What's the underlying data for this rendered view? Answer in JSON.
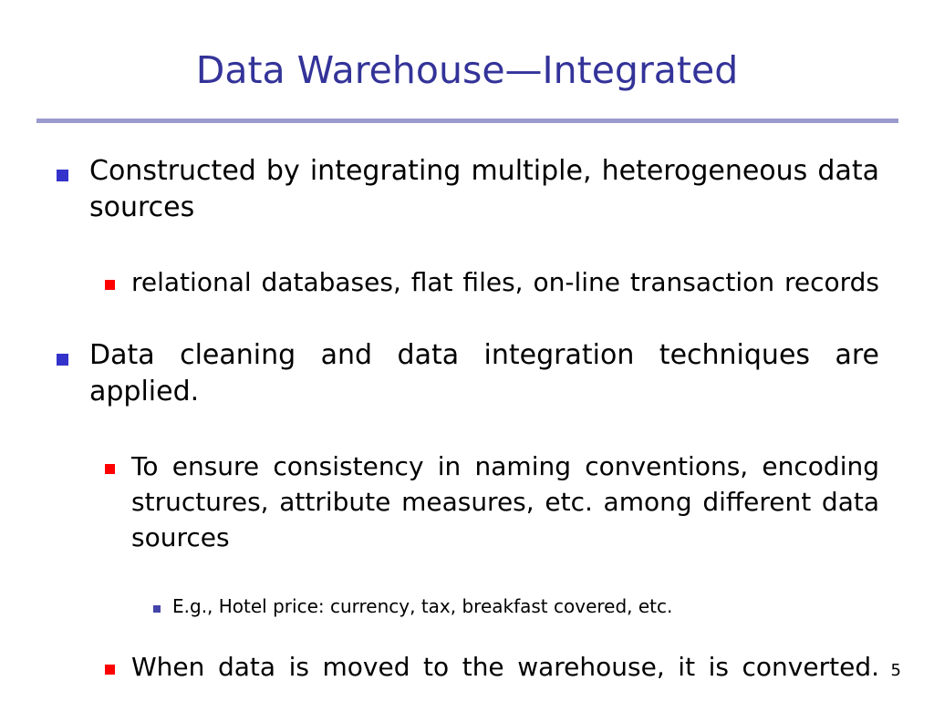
{
  "slide": {
    "title": "Data Warehouse—Integrated",
    "page_number": "5",
    "colors": {
      "title": "#333399",
      "rule": "#9a9ace",
      "level1_bullet": "#3333cc",
      "level2_bullet": "#ff0000",
      "level3_bullet": "#4444aa",
      "body_text": "#000000",
      "background": "#ffffff"
    },
    "bullets": [
      {
        "level": 1,
        "marker": "blue-square-bullet",
        "text": "Constructed by integrating multiple, heterogeneous data sources"
      },
      {
        "level": 2,
        "marker": "red-square-bullet",
        "text": "relational databases, flat files, on-line transaction records"
      },
      {
        "level": 1,
        "marker": "blue-square-bullet",
        "text": "Data cleaning and data integration techniques are applied."
      },
      {
        "level": 2,
        "marker": "red-square-bullet",
        "text": "To ensure consistency in naming conventions, encoding structures, attribute measures, etc. among different data sources"
      },
      {
        "level": 3,
        "marker": "small-blue-square-bullet",
        "text": "E.g., Hotel price: currency, tax, breakfast covered, etc."
      },
      {
        "level": 2,
        "marker": "red-square-bullet",
        "text": "When data is moved to the warehouse, it is converted."
      }
    ]
  }
}
